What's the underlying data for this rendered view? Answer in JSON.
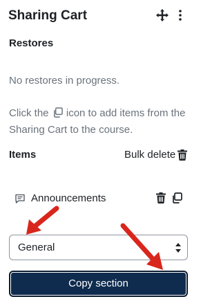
{
  "header": {
    "title": "Sharing Cart",
    "move_icon": "move-icon",
    "menu_icon": "kebab-menu-icon"
  },
  "restores": {
    "title": "Restores",
    "status": "No restores in progress."
  },
  "hint": {
    "before": "Click the",
    "after": "icon to add items from the Sharing Cart to the course.",
    "icon": "copy-icon"
  },
  "items": {
    "title": "Items",
    "bulk_delete_label": "Bulk delete",
    "list": [
      {
        "label": "Announcements",
        "icon": "comment-icon"
      }
    ]
  },
  "section_select": {
    "value": "General"
  },
  "copy_button": {
    "label": "Copy section"
  },
  "colors": {
    "button_bg": "#0f2c4f",
    "arrow": "#d9261c",
    "muted_text": "#6a737b"
  }
}
